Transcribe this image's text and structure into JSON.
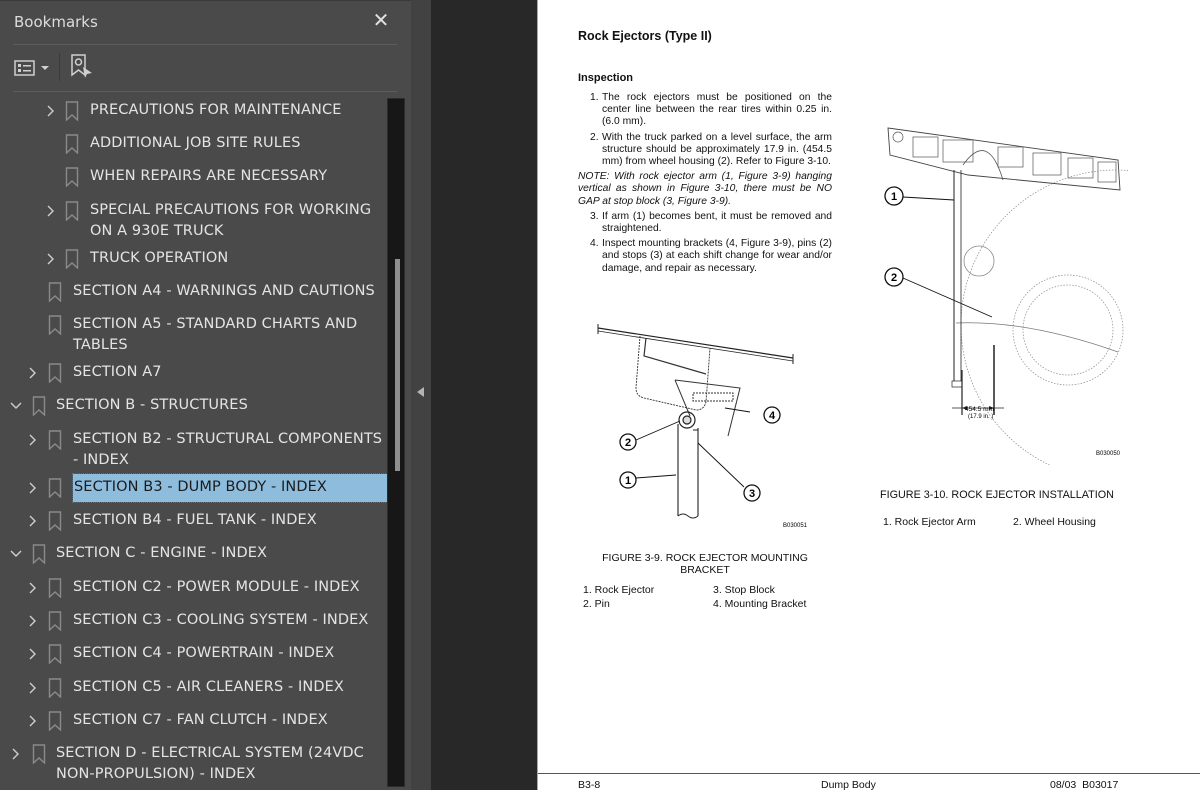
{
  "sidebar": {
    "title": "Bookmarks",
    "close_label": "✕",
    "toolbar": {
      "options_icon": "list-options-icon",
      "find_bookmark_icon": "find-current-bookmark-icon"
    },
    "items": [
      {
        "label": "PRECAUTIONS FOR MAINTENANCE",
        "level": 2,
        "expander": "collapsed"
      },
      {
        "label": "ADDITIONAL JOB SITE RULES",
        "level": 2,
        "expander": "none"
      },
      {
        "label": "WHEN REPAIRS ARE NECESSARY",
        "level": 2,
        "expander": "none"
      },
      {
        "label": "SPECIAL PRECAUTIONS FOR WORKING ON A 930E TRUCK",
        "level": 2,
        "expander": "collapsed"
      },
      {
        "label": "TRUCK OPERATION",
        "level": 2,
        "expander": "collapsed"
      },
      {
        "label": "SECTION A4 - WARNINGS AND CAUTIONS",
        "level": 1,
        "expander": "none"
      },
      {
        "label": "SECTION A5 - STANDARD CHARTS AND TABLES",
        "level": 1,
        "expander": "none"
      },
      {
        "label": "SECTION A7",
        "level": 1,
        "expander": "collapsed"
      },
      {
        "label": "SECTION B - STRUCTURES",
        "level": 0,
        "expander": "expanded"
      },
      {
        "label": "SECTION B2 - STRUCTURAL COMPONENTS - INDEX",
        "level": 1,
        "expander": "collapsed"
      },
      {
        "label": "SECTION B3 - DUMP BODY - INDEX",
        "level": 1,
        "expander": "collapsed",
        "selected": true
      },
      {
        "label": "SECTION B4 - FUEL TANK - INDEX",
        "level": 1,
        "expander": "collapsed"
      },
      {
        "label": "SECTION C - ENGINE - INDEX",
        "level": 0,
        "expander": "expanded"
      },
      {
        "label": "SECTION C2 - POWER MODULE - INDEX",
        "level": 1,
        "expander": "collapsed"
      },
      {
        "label": "SECTION C3 - COOLING SYSTEM - INDEX",
        "level": 1,
        "expander": "collapsed"
      },
      {
        "label": "SECTION C4 - POWERTRAIN - INDEX",
        "level": 1,
        "expander": "collapsed"
      },
      {
        "label": "SECTION C5 - AIR CLEANERS - INDEX",
        "level": 1,
        "expander": "collapsed"
      },
      {
        "label": "SECTION C7 - FAN CLUTCH - INDEX",
        "level": 1,
        "expander": "collapsed"
      },
      {
        "label": "SECTION D - ELECTRICAL SYSTEM (24VDC NON-PROPULSION) - INDEX",
        "level": 0,
        "expander": "collapsed"
      }
    ],
    "selected_color": "#8ebcdc"
  },
  "page": {
    "title": "Rock Ejectors (Type II)",
    "subheading": "Inspection",
    "steps_a": [
      {
        "num": "1.",
        "text": "The rock ejectors must be positioned on the center line between the rear tires within 0.25 in. (6.0 mm)."
      },
      {
        "num": "2.",
        "text": "With the truck parked on a level surface, the arm structure should be approximately 17.9 in. (454.5 mm) from wheel housing (2). Refer to Figure 3-10."
      }
    ],
    "note": "NOTE: With rock ejector arm (1, Figure 3-9) hanging vertical as shown in Figure 3-10, there must be NO GAP at stop block (3, Figure 3-9).",
    "steps_b": [
      {
        "num": "3.",
        "text": "If arm (1) becomes bent, it must be removed and straightened."
      },
      {
        "num": "4.",
        "text": "Inspect mounting brackets (4, Figure 3-9), pins (2) and stops (3) at each shift change for wear and/or damage, and repair as necessary."
      }
    ],
    "figure9": {
      "callouts": [
        "1",
        "2",
        "3",
        "4"
      ],
      "code": "B030051",
      "caption": "FIGURE 3-9. ROCK EJECTOR MOUNTING BRACKET",
      "legend": [
        "1. Rock Ejector",
        "2. Pin",
        "3. Stop Block",
        "4. Mounting Bracket"
      ]
    },
    "figure10": {
      "callouts": [
        "1",
        "2"
      ],
      "dimension_mm": "454.5 mm",
      "dimension_in": "(17.9 in. )",
      "code": "B030050",
      "caption": "FIGURE 3-10. ROCK EJECTOR INSTALLATION",
      "legend": [
        "1. Rock Ejector Arm",
        "2. Wheel Housing"
      ]
    },
    "footer": {
      "page_number": "B3-8",
      "section": "Dump Body",
      "date_code": "08/03  B03017"
    }
  }
}
